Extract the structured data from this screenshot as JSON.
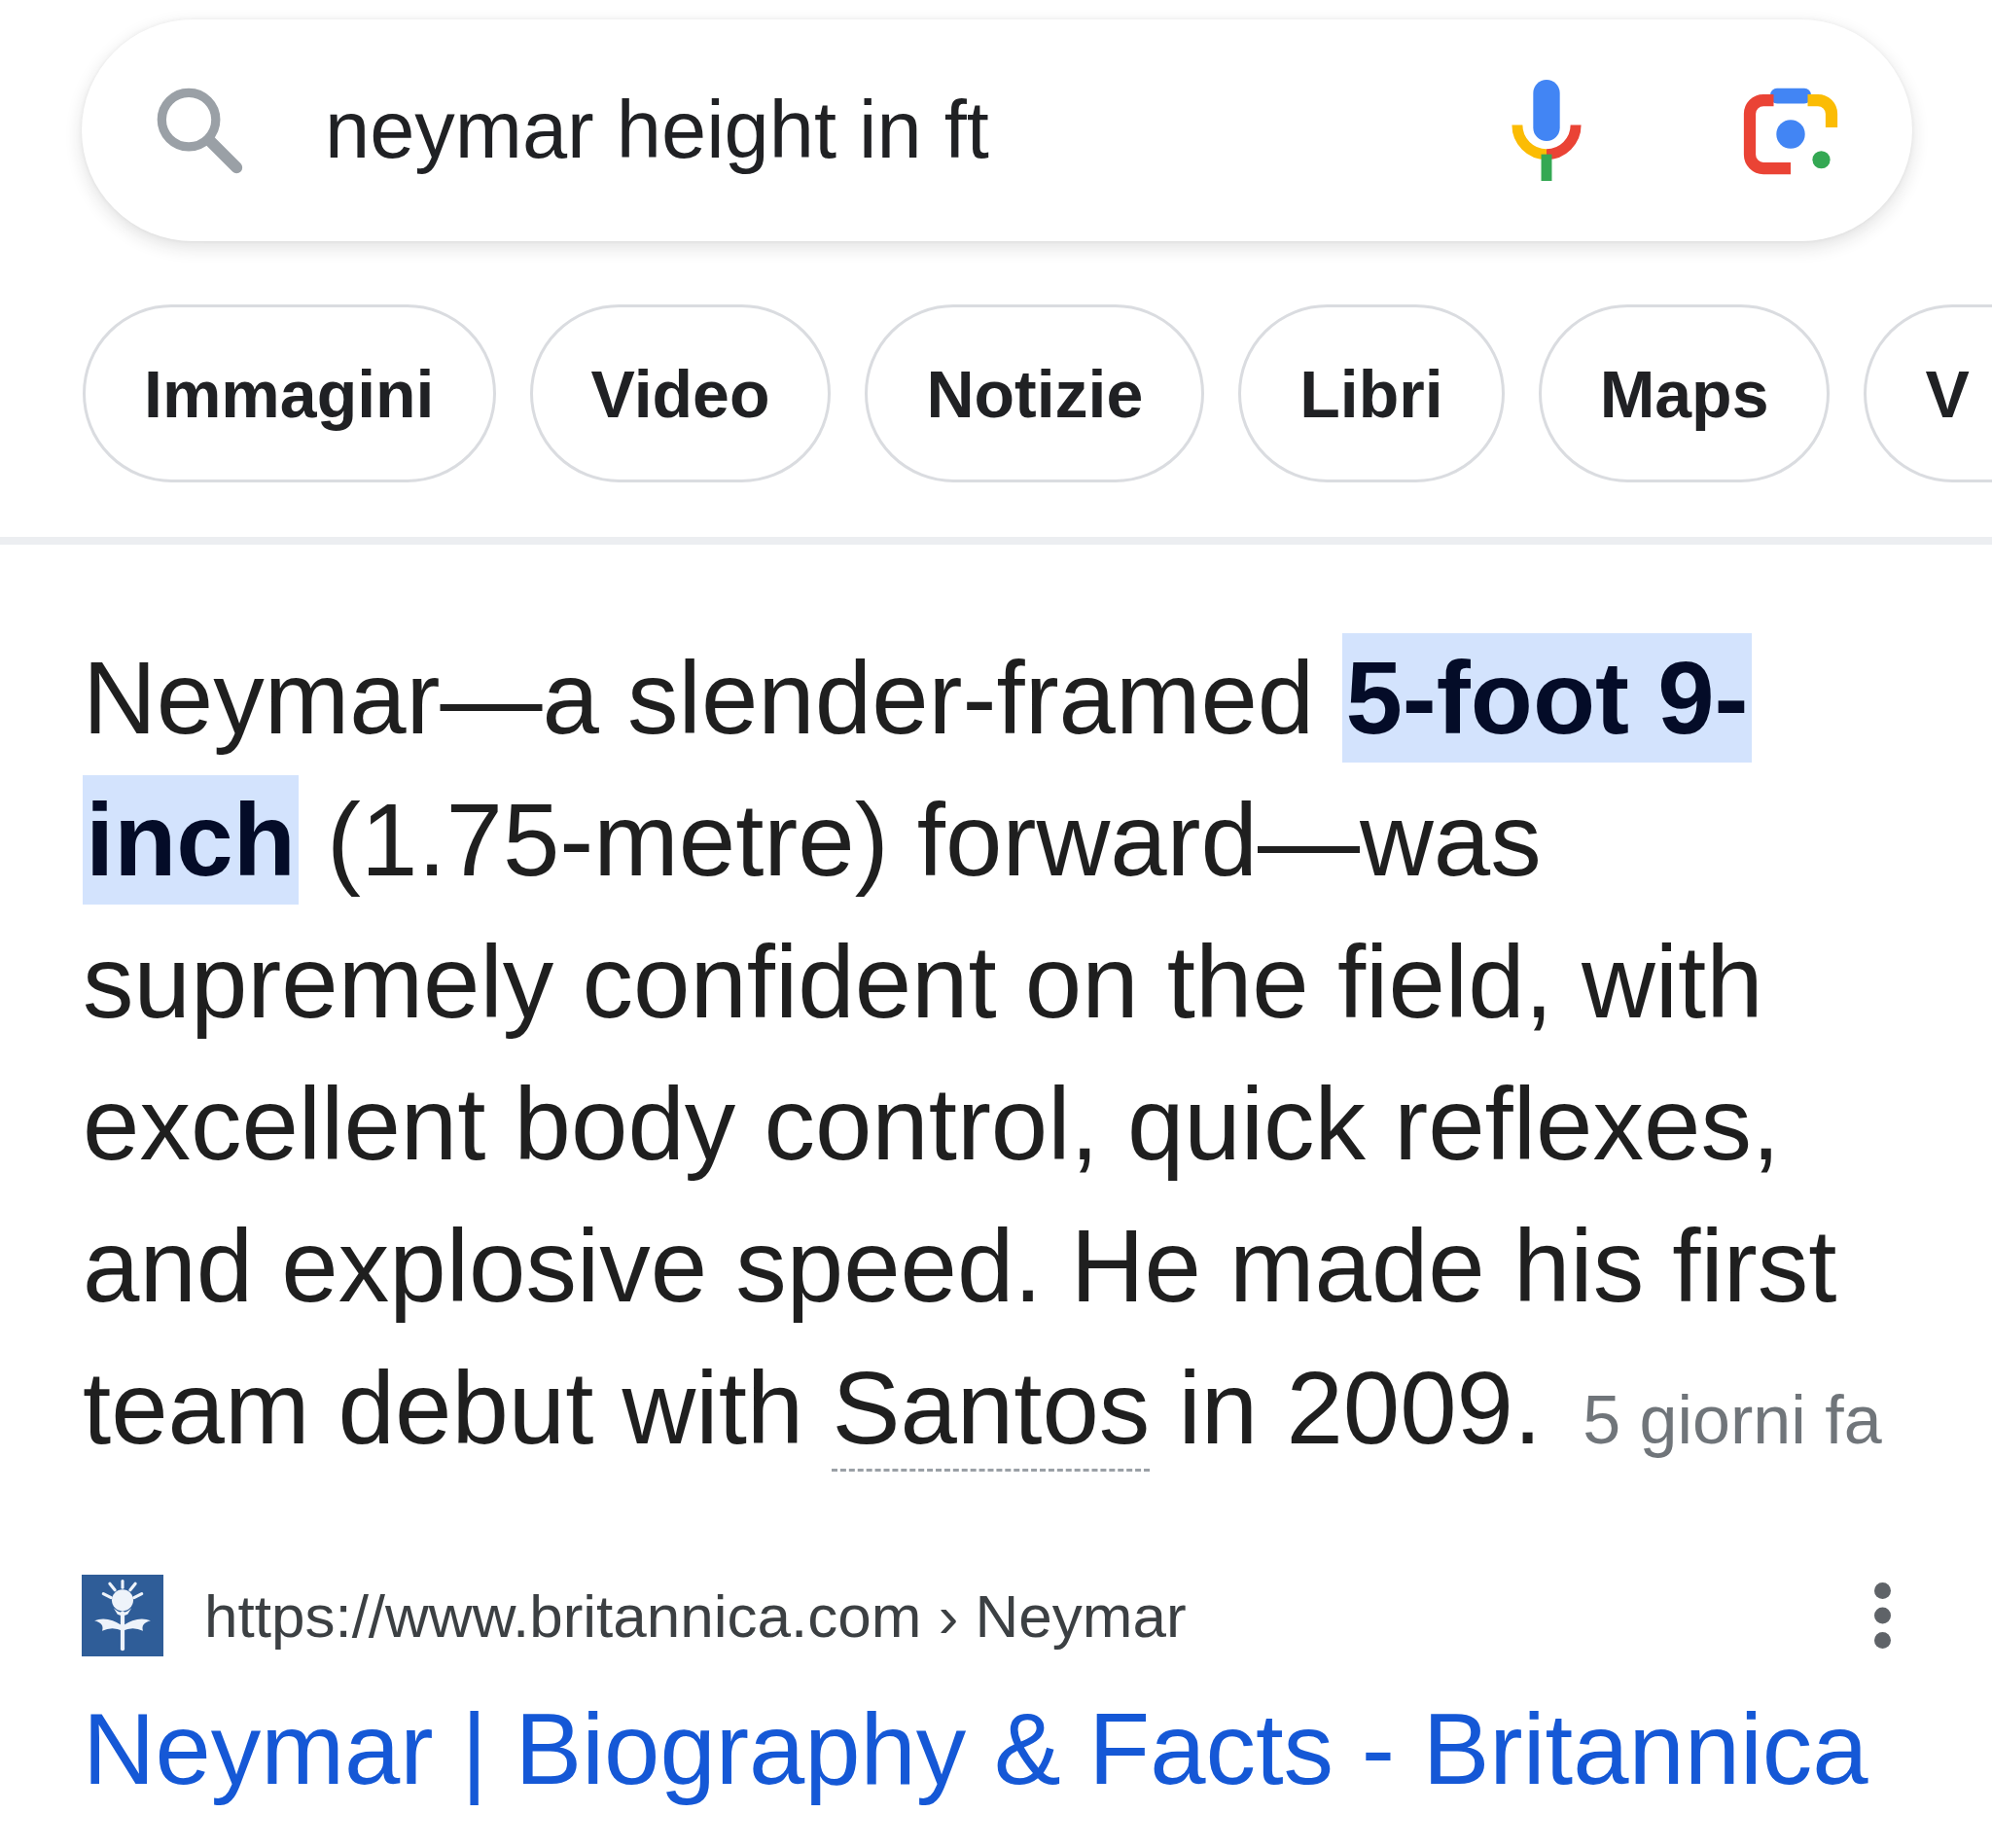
{
  "search_bar": {
    "value": "neymar height in ft"
  },
  "chips": [
    {
      "label": "Immagini"
    },
    {
      "label": "Video"
    },
    {
      "label": "Notizie"
    },
    {
      "label": "Libri"
    },
    {
      "label": "Maps"
    },
    {
      "label": "V"
    }
  ],
  "featured_snippet": {
    "segments": [
      {
        "kind": "text",
        "text": "Neymar—a slender-framed **5-foot 9-inch** (1.75-metre) forward—was supremely confident on the field, with excellent body control, quick reflexes, and explosive speed. He made his first team debut with "
      },
      {
        "kind": "link",
        "text": "Santos"
      },
      {
        "kind": "text",
        "text": " in 2009."
      }
    ],
    "date": "5 giorni fa"
  },
  "source": {
    "url": "https://www.britannica.com › Neymar",
    "title": "Neymar | Biography & Facts - Britannica"
  }
}
